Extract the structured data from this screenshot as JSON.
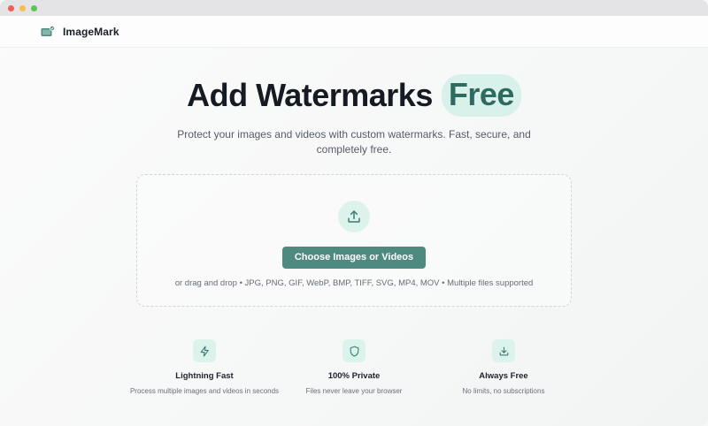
{
  "colors": {
    "accent": "#4f8a81",
    "accent_light": "#dcf3ec",
    "highlight_text": "#2f6a62"
  },
  "navbar": {
    "brand_name": "ImageMark",
    "logo_icon": "image-watermark-logo-icon"
  },
  "hero": {
    "title": "Add Watermarks",
    "highlight": "Free",
    "subtitle": "Protect your images and videos with custom watermarks. Fast, secure, and completely free."
  },
  "dropzone": {
    "icon": "upload-icon",
    "button_label": "Choose Images or Videos",
    "hint": "or drag and drop • JPG, PNG, GIF, WebP, BMP, TIFF, SVG, MP4, MOV • Multiple files supported"
  },
  "features": [
    {
      "icon": "lightning-icon",
      "title": "Lightning Fast",
      "description": "Process multiple images and videos in seconds"
    },
    {
      "icon": "shield-icon",
      "title": "100% Private",
      "description": "Files never leave your browser"
    },
    {
      "icon": "download-icon",
      "title": "Always Free",
      "description": "No limits, no subscriptions"
    }
  ]
}
